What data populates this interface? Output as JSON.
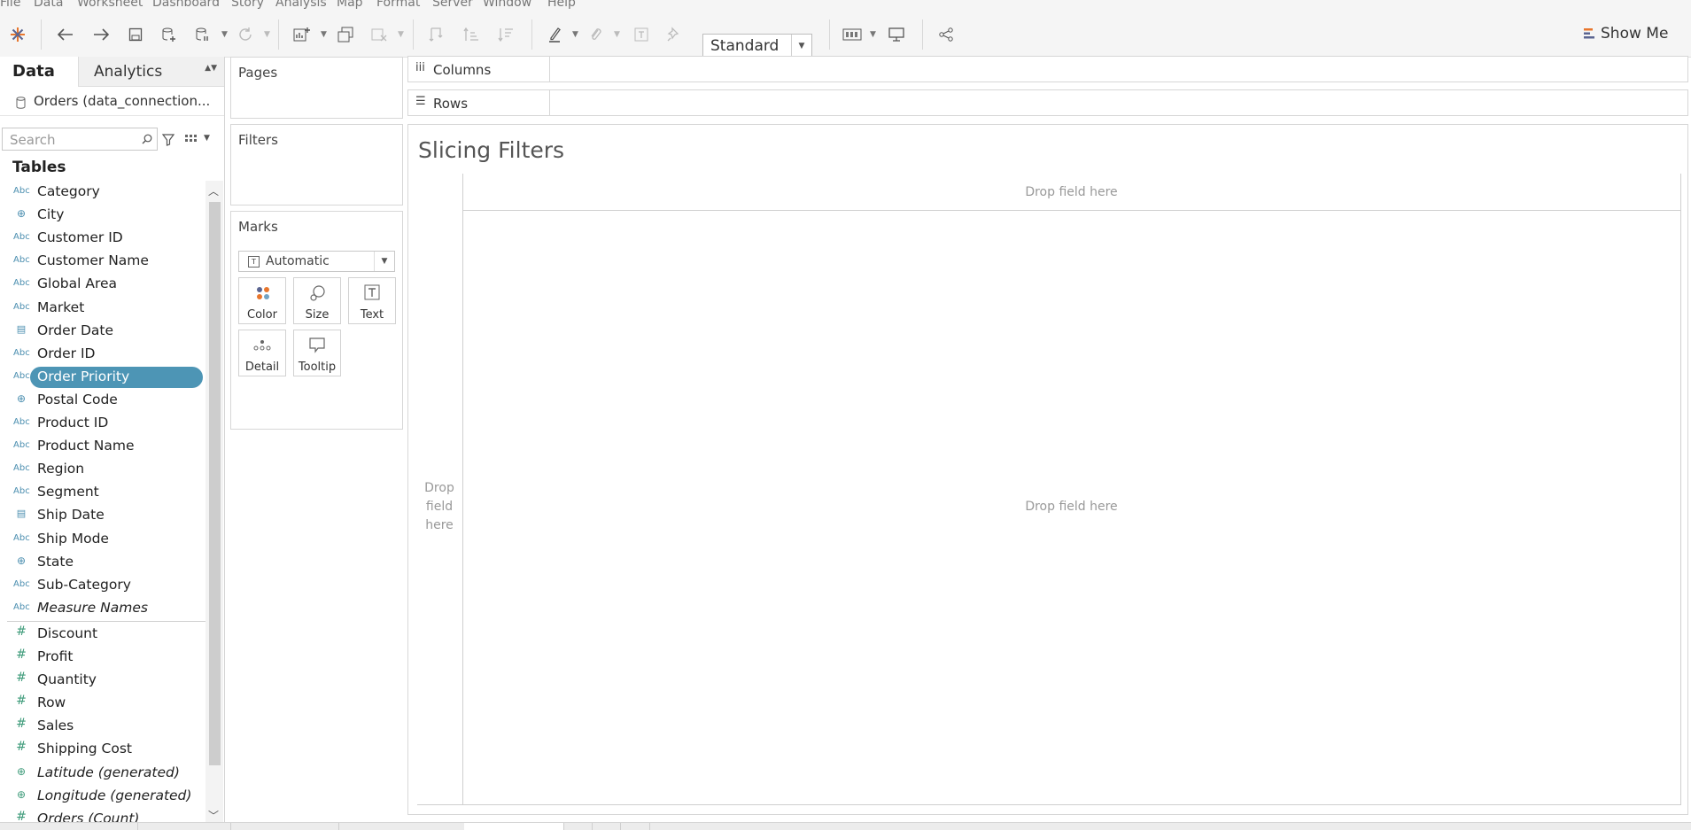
{
  "menu": [
    "File",
    "Data",
    "Worksheet",
    "Dashboard",
    "Story",
    "Analysis",
    "Map",
    "Format",
    "Server",
    "Window",
    "Help"
  ],
  "toolbar": {
    "fit_value": "Standard",
    "show_me_label": "Show Me"
  },
  "data_pane": {
    "tab_data": "Data",
    "tab_analytics": "Analytics",
    "datasource": "Orders (data_connection...",
    "search_placeholder": "Search",
    "tables_heading": "Tables",
    "dimensions": [
      {
        "icon": "Abc",
        "name": "Category"
      },
      {
        "icon": "geo",
        "name": "City"
      },
      {
        "icon": "Abc",
        "name": "Customer ID"
      },
      {
        "icon": "Abc",
        "name": "Customer Name"
      },
      {
        "icon": "Abc",
        "name": "Global Area"
      },
      {
        "icon": "Abc",
        "name": "Market"
      },
      {
        "icon": "date",
        "name": "Order Date"
      },
      {
        "icon": "Abc",
        "name": "Order ID"
      },
      {
        "icon": "Abc",
        "name": "Order Priority",
        "selected": true
      },
      {
        "icon": "geo",
        "name": "Postal Code"
      },
      {
        "icon": "Abc",
        "name": "Product ID"
      },
      {
        "icon": "Abc",
        "name": "Product Name"
      },
      {
        "icon": "Abc",
        "name": "Region"
      },
      {
        "icon": "Abc",
        "name": "Segment"
      },
      {
        "icon": "date",
        "name": "Ship Date"
      },
      {
        "icon": "Abc",
        "name": "Ship Mode"
      },
      {
        "icon": "geo",
        "name": "State"
      },
      {
        "icon": "Abc",
        "name": "Sub-Category"
      },
      {
        "icon": "Abc",
        "name": "Measure Names",
        "italic": true
      }
    ],
    "measures": [
      {
        "icon": "#",
        "name": "Discount"
      },
      {
        "icon": "#",
        "name": "Profit"
      },
      {
        "icon": "#",
        "name": "Quantity"
      },
      {
        "icon": "#",
        "name": "Row"
      },
      {
        "icon": "#",
        "name": "Sales"
      },
      {
        "icon": "#",
        "name": "Shipping Cost"
      },
      {
        "icon": "geo",
        "name": "Latitude (generated)",
        "italic": true
      },
      {
        "icon": "geo",
        "name": "Longitude (generated)",
        "italic": true
      },
      {
        "icon": "#",
        "name": "Orders (Count)",
        "italic": true
      }
    ]
  },
  "cards": {
    "pages": "Pages",
    "filters": "Filters",
    "marks": "Marks",
    "mark_type": "Automatic",
    "mark_buttons": [
      "Color",
      "Size",
      "Text",
      "Detail",
      "Tooltip"
    ]
  },
  "shelves": {
    "columns": "Columns",
    "rows": "Rows"
  },
  "view": {
    "title": "Slicing Filters",
    "drop_top": "Drop field here",
    "drop_left": "Drop\nfield\nhere",
    "drop_center": "Drop field here"
  },
  "colors": {
    "accent": "#4d95b5",
    "dimension_icon": "#4c8fb0",
    "measure_icon": "#3e9b7a"
  }
}
